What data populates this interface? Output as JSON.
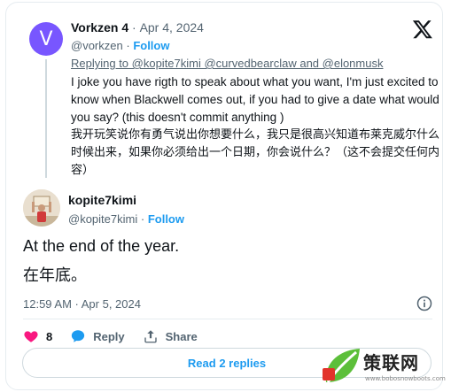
{
  "parent": {
    "avatar_letter": "V",
    "name": "Vorkzen 4",
    "separator": "·",
    "date": "Apr 4, 2024",
    "handle": "@vorkzen",
    "follow_label": "Follow",
    "replying_to": "Replying to @kopite7kimi @curvedbearclaw and @elonmusk",
    "text": "I joke you have rigth to speak about what you want, I'm just excited to know when Blackwell comes out, if you had to give a date what would you say? (this doesn't commit anything )",
    "translation": "我开玩笑说你有勇气说出你想要什么，我只是很高兴知道布莱克威尔什么时候出来，如果你必须给出一个日期，你会说什么？（这不会提交任何内容）"
  },
  "main": {
    "name": "kopite7kimi",
    "handle": "@kopite7kimi",
    "separator": "·",
    "follow_label": "Follow",
    "text": "At the end of the year.",
    "translation": "在年底。",
    "timestamp": "12:59 AM · Apr 5, 2024"
  },
  "actions": {
    "like_count": "8",
    "reply_label": "Reply",
    "share_label": "Share"
  },
  "read_replies_label": "Read 2 replies",
  "watermark": {
    "text": "策联网",
    "sub": "www.bobosnowboots.com"
  },
  "colors": {
    "accent": "#1d9bf0",
    "heart": "#f91880",
    "avatar_v": "#7856ff",
    "muted": "#536471"
  }
}
